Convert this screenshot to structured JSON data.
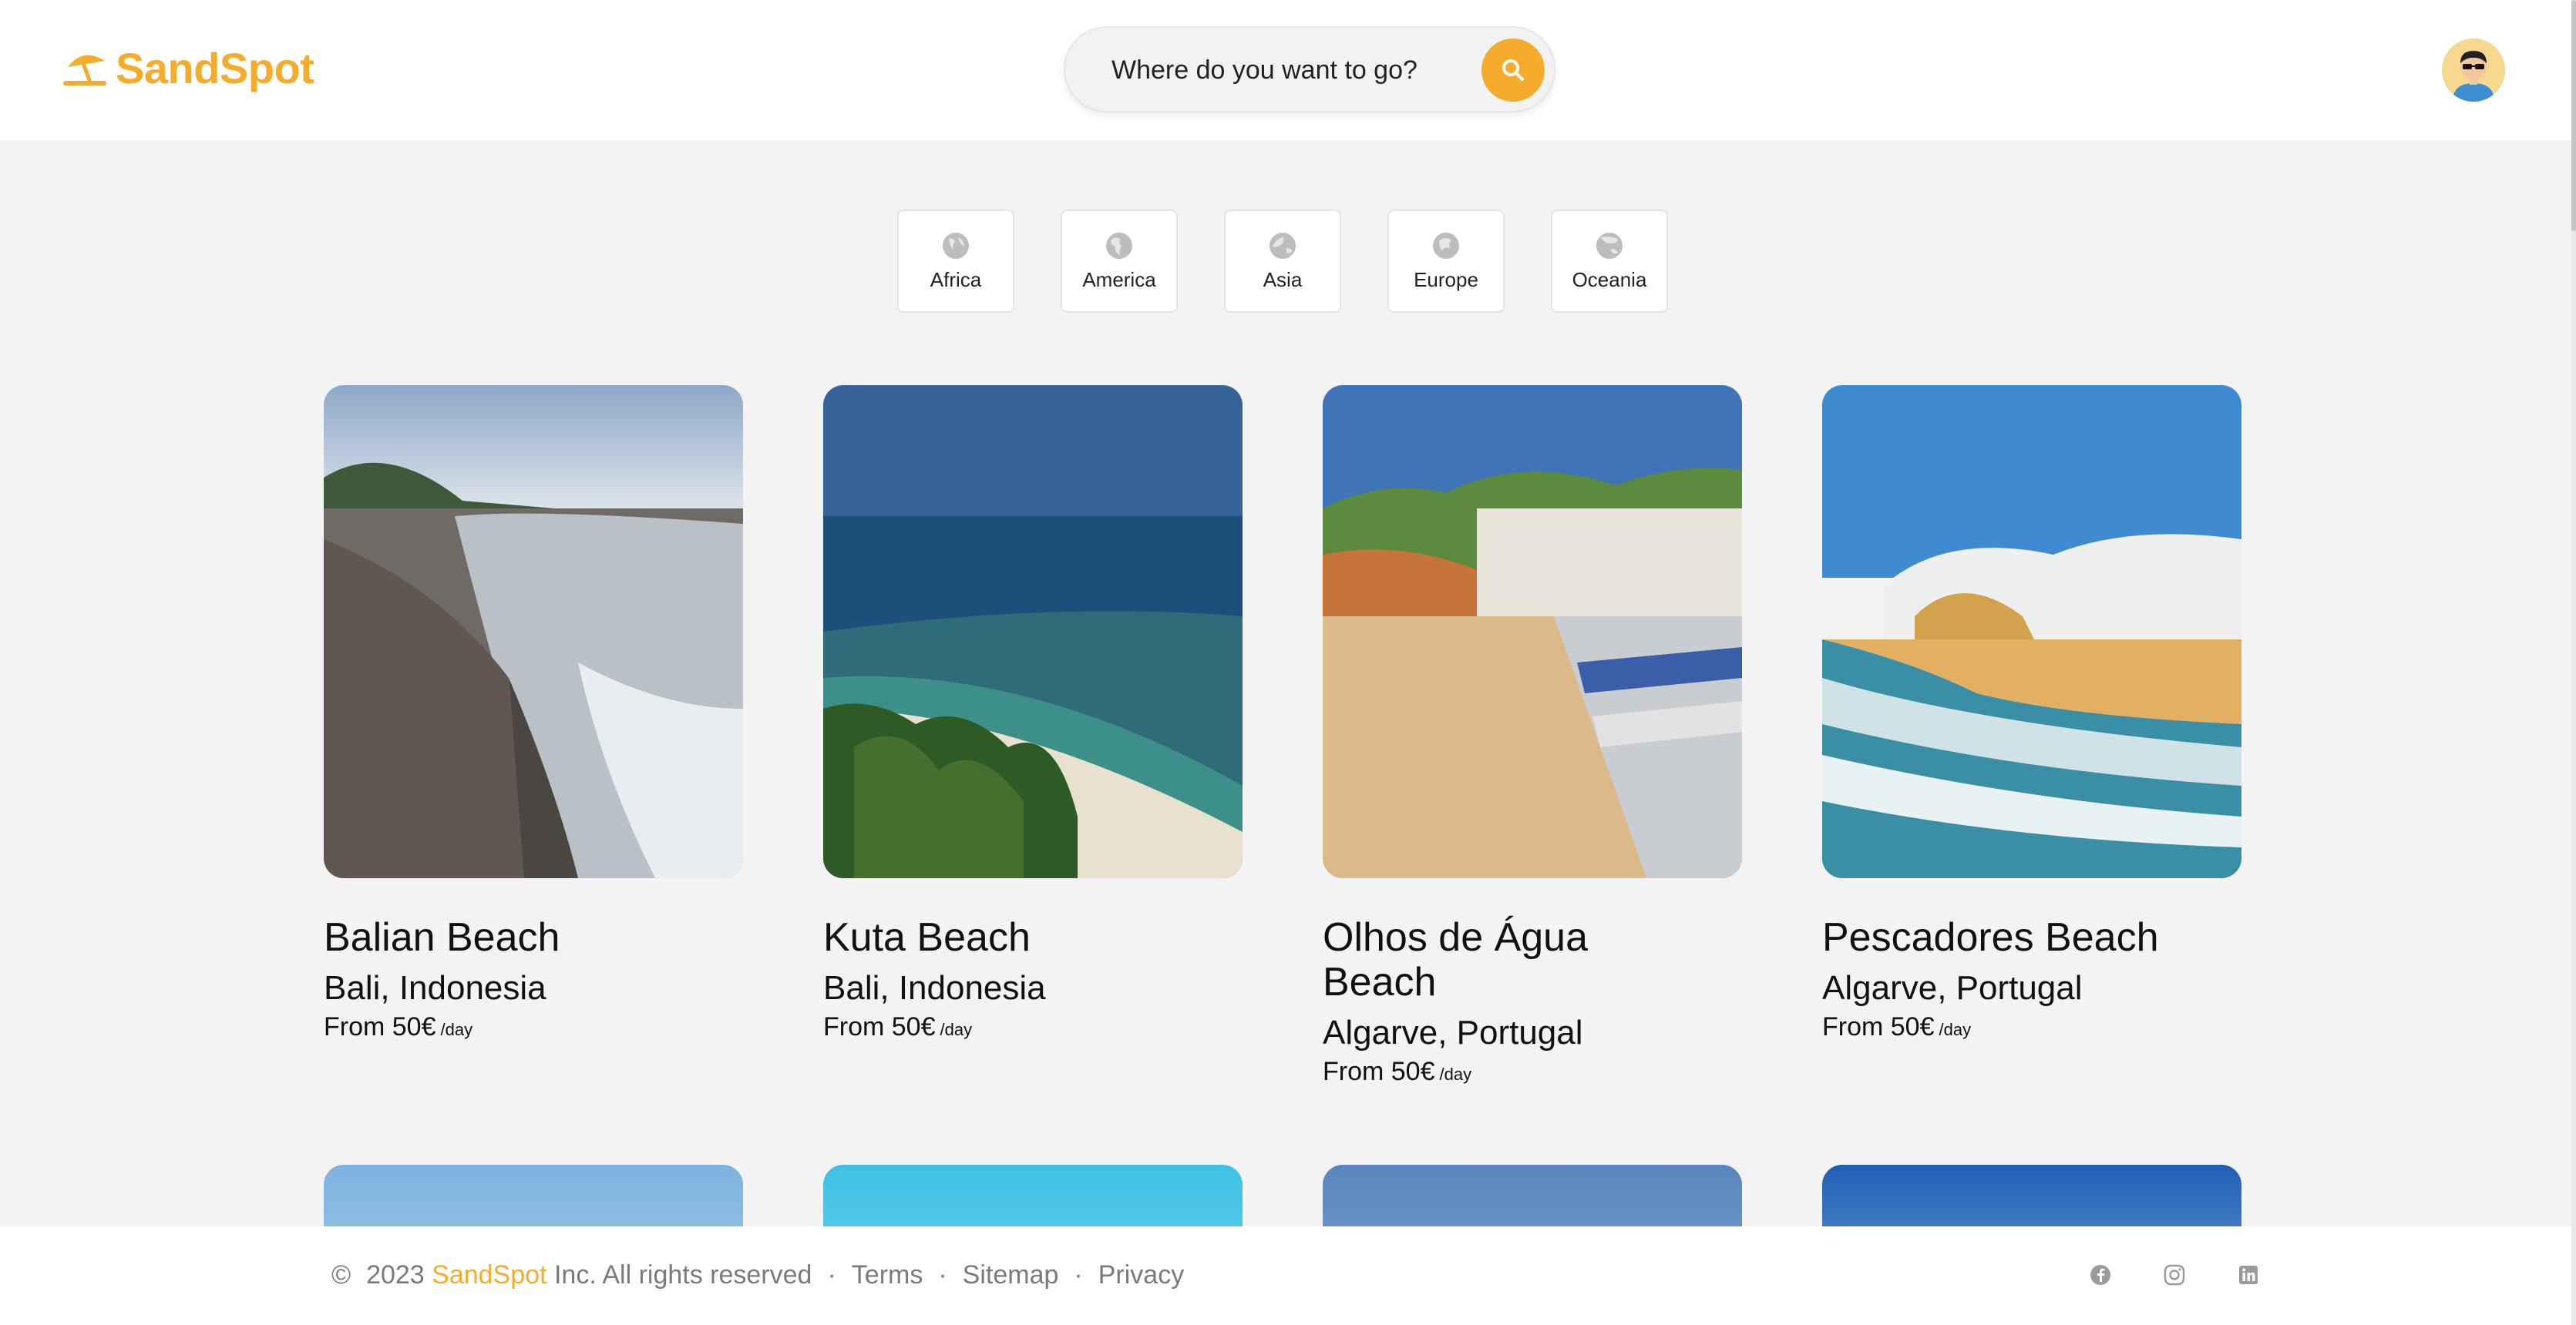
{
  "brand": {
    "name": "SandSpot",
    "color": "#f5ac2d"
  },
  "search": {
    "placeholder": "Where do you want to go?",
    "icon": "search-icon"
  },
  "avatar": {
    "icon": "user-avatar"
  },
  "regions": [
    {
      "label": "Africa",
      "icon": "globe-icon"
    },
    {
      "label": "America",
      "icon": "globe-icon"
    },
    {
      "label": "Asia",
      "icon": "globe-icon"
    },
    {
      "label": "Europe",
      "icon": "globe-icon"
    },
    {
      "label": "Oceania",
      "icon": "globe-icon"
    }
  ],
  "beaches": [
    {
      "name": "Balian Beach",
      "location": "Bali, Indonesia",
      "price": "From 50€",
      "unit": "/day"
    },
    {
      "name": "Kuta Beach",
      "location": "Bali, Indonesia",
      "price": "From 50€",
      "unit": "/day"
    },
    {
      "name": "Olhos de Água Beach",
      "location": "Algarve, Portugal",
      "price": "From 50€",
      "unit": "/day"
    },
    {
      "name": "Pescadores Beach",
      "location": "Algarve, Portugal",
      "price": "From 50€",
      "unit": "/day"
    }
  ],
  "footer": {
    "copyright": "©",
    "year": "2023",
    "brand": "SandSpot",
    "rights": "Inc. All rights reserved",
    "sep": "·",
    "links": [
      "Terms",
      "Sitemap",
      "Privacy"
    ],
    "social": [
      "facebook-icon",
      "instagram-icon",
      "linkedin-icon"
    ]
  }
}
